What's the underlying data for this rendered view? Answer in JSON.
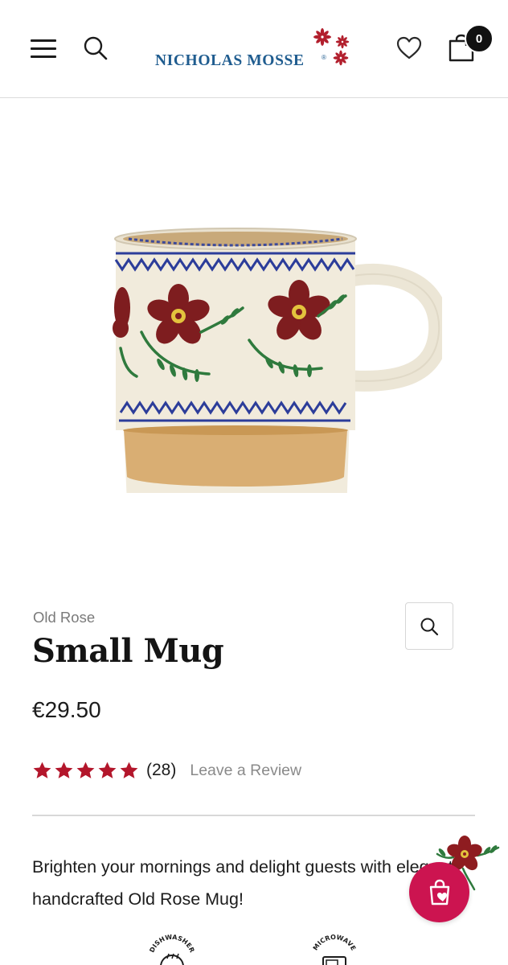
{
  "header": {
    "logo_text": "NICHOLAS MOSSE",
    "logo_reg": "®",
    "cart_count": "0"
  },
  "product": {
    "collection": "Old Rose",
    "title": "Small Mug",
    "price": "€29.50",
    "rating": {
      "stars": 5,
      "max": 5,
      "count": "(28)",
      "leave_review_label": "Leave a Review"
    },
    "description": "Brighten your mornings and delight guests with elegant, handcrafted Old Rose Mug!"
  },
  "features": [
    {
      "label": "DISHWASHER",
      "icon": "dishwasher-safe-icon"
    },
    {
      "label": "MICROWAVE",
      "icon": "microwave-safe-icon"
    }
  ],
  "colors": {
    "brand_blue": "#1f5c8f",
    "star_red": "#b3162b",
    "bag_button": "#cc1450"
  }
}
